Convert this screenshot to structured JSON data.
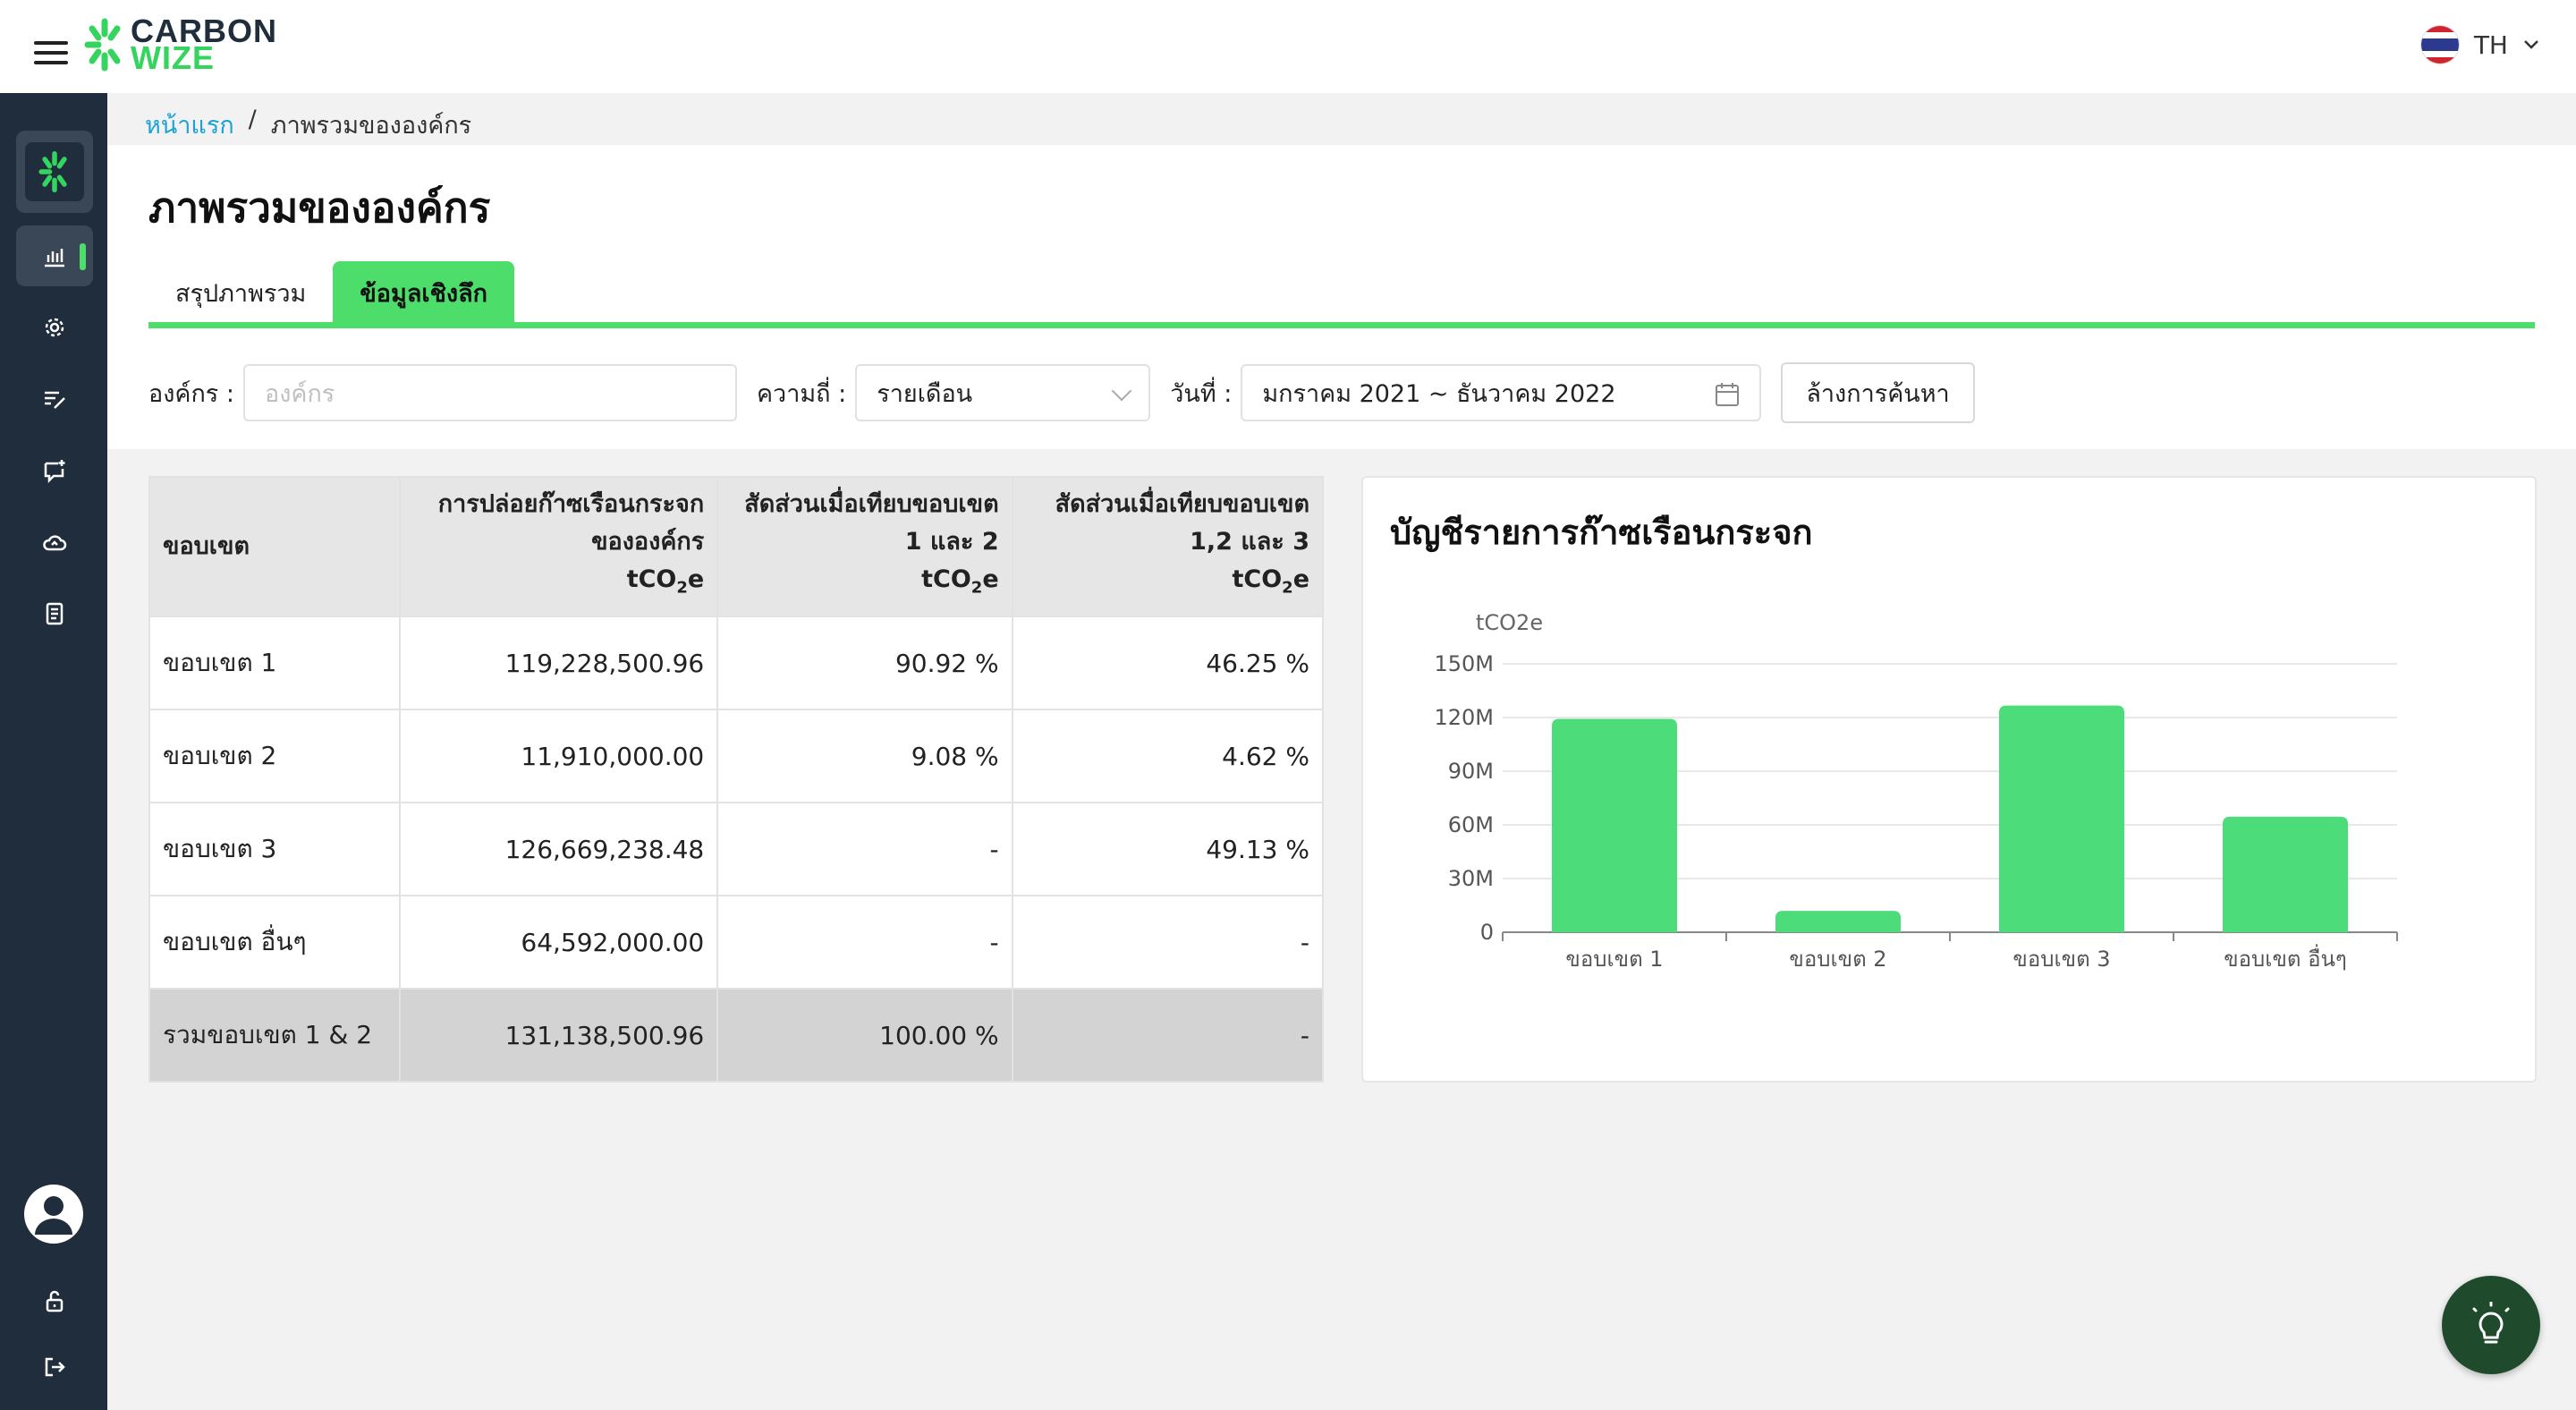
{
  "header": {
    "logo_line1": "CARBON",
    "logo_line2": "WIZE",
    "lang_label": "TH"
  },
  "breadcrumb": {
    "home": "หน้าแรก",
    "separator": "/",
    "current": "ภาพรวมขององค์กร"
  },
  "page_title": "ภาพรวมขององค์กร",
  "tabs": [
    {
      "label": "สรุปภาพรวม",
      "active": false
    },
    {
      "label": "ข้อมูลเชิงลึก",
      "active": true
    }
  ],
  "filters": {
    "org_label": "องค์กร :",
    "org_placeholder": "องค์กร",
    "freq_label": "ความถี่ :",
    "freq_value": "รายเดือน",
    "date_label": "วันที่ :",
    "date_value": "มกราคม 2021 ~ ธันวาคม 2022",
    "clear_label": "ล้างการค้นหา"
  },
  "table": {
    "headers": {
      "scope": "ขอบเขต",
      "emission_l1": "การปล่อยก๊าซเรือนกระจก",
      "emission_l2": "ขององค์กร",
      "unit": "tCO",
      "unit_sub": "2",
      "unit_e": "e",
      "ratio12_l1": "สัดส่วนเมื่อเทียบขอบเขต",
      "ratio12_l2": "1 และ 2",
      "ratio123_l1": "สัดส่วนเมื่อเทียบขอบเขต",
      "ratio123_l2": "1,2 และ 3"
    },
    "rows": [
      {
        "scope": "ขอบเขต 1",
        "emission": "119,228,500.96",
        "ratio12": "90.92 %",
        "ratio123": "46.25 %"
      },
      {
        "scope": "ขอบเขต 2",
        "emission": "11,910,000.00",
        "ratio12": "9.08 %",
        "ratio123": "4.62 %"
      },
      {
        "scope": "ขอบเขต 3",
        "emission": "126,669,238.48",
        "ratio12": "-",
        "ratio123": "49.13 %"
      },
      {
        "scope": "ขอบเขต อื่นๆ",
        "emission": "64,592,000.00",
        "ratio12": "-",
        "ratio123": "-"
      }
    ],
    "total": {
      "scope": "รวมขอบเขต 1 & 2",
      "emission": "131,138,500.96",
      "ratio12": "100.00 %",
      "ratio123": "-"
    }
  },
  "chart_title": "บัญชีรายการก๊าซเรือนกระจก",
  "chart_data": {
    "type": "bar",
    "title": "บัญชีรายการก๊าซเรือนกระจก",
    "ylabel": "tCO2e",
    "xlabel": "",
    "categories": [
      "ขอบเขต 1",
      "ขอบเขต 2",
      "ขอบเขต 3",
      "ขอบเขต อื่นๆ"
    ],
    "values": [
      119228500.96,
      11910000.0,
      126669238.48,
      64592000.0
    ],
    "ylim": [
      0,
      150000000
    ],
    "yticks": [
      0,
      30000000,
      60000000,
      90000000,
      120000000,
      150000000
    ],
    "ytick_labels": [
      "0",
      "30M",
      "60M",
      "90M",
      "120M",
      "150M"
    ],
    "bar_color": "#4cdd7a",
    "grid": true
  },
  "colors": {
    "accent": "#4cdd6b",
    "sidebar": "#1f2d3d",
    "link": "#1aa3d6"
  },
  "icons": {
    "menu": "hamburger-icon",
    "dashboard": "bar-chart-icon",
    "settings": "gear-icon",
    "edit": "edit-list-icon",
    "chat": "message-icon",
    "cloud": "cloud-upload-icon",
    "report": "document-icon",
    "lock": "lock-open-icon",
    "logout": "logout-icon",
    "help": "lightbulb-icon"
  }
}
